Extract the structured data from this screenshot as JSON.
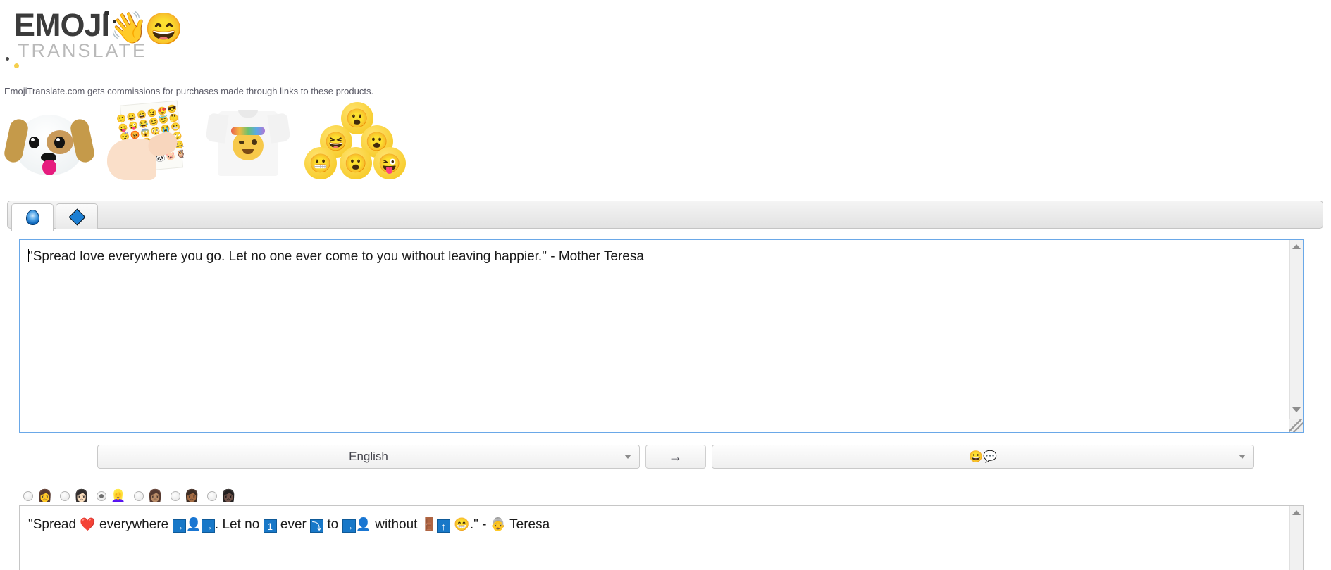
{
  "site": {
    "logo_primary": "EMOJI",
    "logo_secondary": "TRANSLATE",
    "logo_wave_icon": "waving-hand",
    "logo_smile_icon": "grinning-face-smiling-eyes",
    "logo_wave_glyph": "👋",
    "logo_smile_glyph": "😄"
  },
  "affiliate": {
    "notice": "EmojiTranslate.com gets commissions for purchases made through links to these products."
  },
  "products": [
    {
      "name": "emoji-dog-plush-pillow",
      "glyph": "🐶"
    },
    {
      "name": "emoji-sticker-sheet",
      "glyph": "😀"
    },
    {
      "name": "emoji-flower-crown-tshirt",
      "glyph": "😉"
    },
    {
      "name": "emoji-plush-ball-set",
      "glyph": "😮"
    }
  ],
  "tabs": [
    {
      "id": "translate-tab",
      "icon": "gem-globe-icon",
      "active": true
    },
    {
      "id": "secondary-tab",
      "icon": "blue-diamond-icon",
      "active": false
    }
  ],
  "input": {
    "value": "\"Spread love everywhere you go. Let no one ever come to you without leaving happier.\" - Mother Teresa",
    "placeholder": ""
  },
  "controls": {
    "source_language": "English",
    "target_language_glyphs": "😀💬",
    "target_language_label": "Emoji",
    "translate_button_label": "→",
    "dropdown_caret_icon": "chevron-down-icon"
  },
  "skin_tones": [
    {
      "id": "tone-default",
      "glyph": "👩",
      "selected": false
    },
    {
      "id": "tone-light",
      "glyph": "👩🏻",
      "selected": false
    },
    {
      "id": "tone-medium-light",
      "glyph": "👱‍♀️",
      "selected": true
    },
    {
      "id": "tone-medium",
      "glyph": "👩🏽",
      "selected": false
    },
    {
      "id": "tone-medium-dark",
      "glyph": "👩🏾",
      "selected": false
    },
    {
      "id": "tone-dark",
      "glyph": "👩🏿",
      "selected": false
    }
  ],
  "output": {
    "segments": [
      {
        "kind": "text",
        "value": "\"Spread "
      },
      {
        "kind": "emoji",
        "value": "❤️",
        "name": "red-heart-emoji"
      },
      {
        "kind": "text",
        "value": " everywhere "
      },
      {
        "kind": "keycap",
        "value": "→",
        "name": "right-arrow-box"
      },
      {
        "kind": "emoji",
        "value": "👤",
        "name": "bust-in-silhouette-emoji"
      },
      {
        "kind": "keycap",
        "value": "→",
        "name": "right-arrow-box"
      },
      {
        "kind": "text",
        "value": ". Let no "
      },
      {
        "kind": "keycap",
        "value": "1",
        "name": "keycap-one"
      },
      {
        "kind": "text",
        "value": " ever "
      },
      {
        "kind": "keycap",
        "value": "⤵",
        "name": "down-curve-arrow-box"
      },
      {
        "kind": "text",
        "value": " to "
      },
      {
        "kind": "keycap",
        "value": "→",
        "name": "right-arrow-box"
      },
      {
        "kind": "emoji",
        "value": "👤",
        "name": "bust-in-silhouette-emoji"
      },
      {
        "kind": "text",
        "value": " without "
      },
      {
        "kind": "emoji",
        "value": "🚪",
        "name": "door-emoji"
      },
      {
        "kind": "keycap",
        "value": "↑",
        "name": "up-arrow-box"
      },
      {
        "kind": "text",
        "value": " "
      },
      {
        "kind": "emoji",
        "value": "😁",
        "name": "beaming-face-emoji"
      },
      {
        "kind": "text",
        "value": ".\" - "
      },
      {
        "kind": "emoji",
        "value": "👵",
        "name": "older-woman-emoji"
      },
      {
        "kind": "text",
        "value": " Teresa"
      }
    ],
    "plain": "\"Spread ❤️ everywhere →👤→. Let no 1 ever ⤵ to →👤 without 🚪↑ 😁.\" - 👵 Teresa"
  },
  "colors": {
    "accent_blue": "#1878c8",
    "focus_border": "#6aa8e8",
    "logo_dark": "#3b3b3b",
    "logo_grey": "#b9b9b9",
    "logo_yellow": "#f5cf4d"
  }
}
